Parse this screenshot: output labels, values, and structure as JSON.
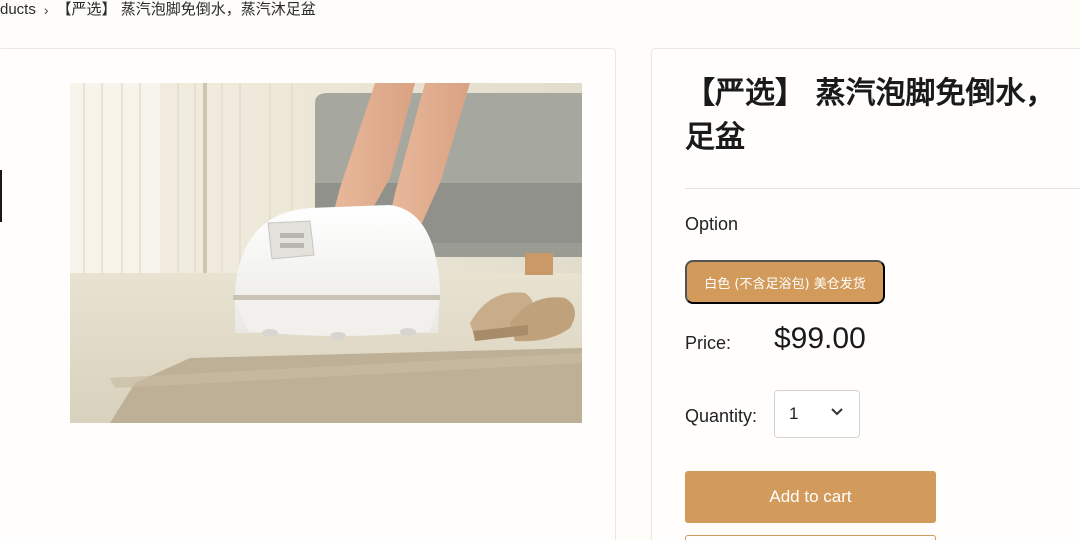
{
  "breadcrumb": {
    "parent": "ducts",
    "separator": "›",
    "current": "【严选】 蒸汽泡脚免倒水，蒸汽沐足盆"
  },
  "product": {
    "title_line1": "【严选】 蒸汽泡脚免倒水，",
    "title_line2": "足盆",
    "option_label": "Option",
    "option_selected": "白色 (不含足浴包) 美仓发货",
    "price_label": "Price:",
    "price": "$99.00",
    "quantity_label": "Quantity:",
    "quantity": "1",
    "add_to_cart_label": "Add to cart"
  },
  "icons": {
    "breadcrumb_separator": "chevron-right-icon",
    "quantity_dropdown": "chevron-down-icon"
  },
  "colors": {
    "accent": "#d29b5b",
    "background": "#fdfcf9"
  }
}
